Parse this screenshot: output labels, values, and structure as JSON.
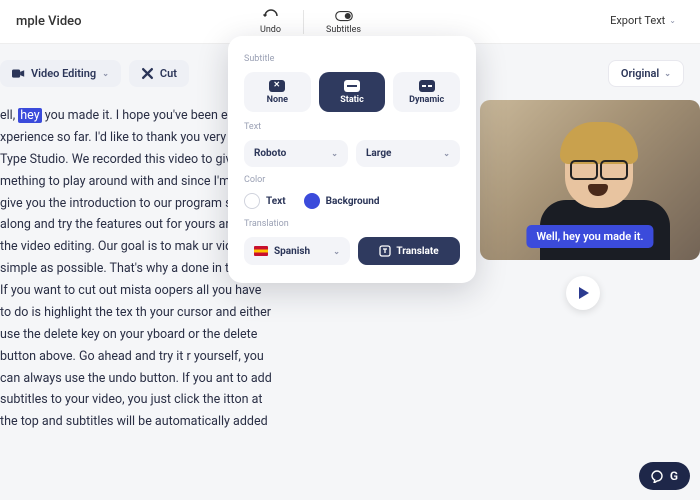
{
  "header": {
    "title": "mple Video",
    "undo_label": "Undo",
    "subtitles_label": "Subtitles",
    "export_label": "Export Text"
  },
  "toolbar": {
    "video_editing_label": "Video Editing",
    "cut_label": "Cut"
  },
  "transcript": {
    "pre": "ell, ",
    "highlight": "hey",
    "post": " you made it. I hope you've been enjo xperience so far. I'd like to thank you very mu t Type Studio. We recorded this video to giv mething to play around with and since I'm al n give you the introduction to our program s llow along and try the features out for yours art with the video editing. Our goal is to mak ur video as simple as possible. That's why a done in the text. If you want to cut out mista oopers all you have to do is highlight the tex th your cursor and either use the delete key on your yboard or the delete button above. Go ahead and try it r yourself, you can always use the undo button. If you ant to add subtitles to your video, you just click the itton at the top and subtitles will be automatically added"
  },
  "panel": {
    "subtitle_label": "Subtitle",
    "opts": {
      "none": "None",
      "static": "Static",
      "dynamic": "Dynamic"
    },
    "text_label": "Text",
    "font": "Roboto",
    "size": "Large",
    "color_label": "Color",
    "text_color": "Text",
    "bg_color": "Background",
    "translation_label": "Translation",
    "lang": "Spanish",
    "translate_btn": "Translate"
  },
  "preview": {
    "original_label": "Original",
    "caption": "Well, hey you made it."
  },
  "chat": {
    "label": "G"
  }
}
